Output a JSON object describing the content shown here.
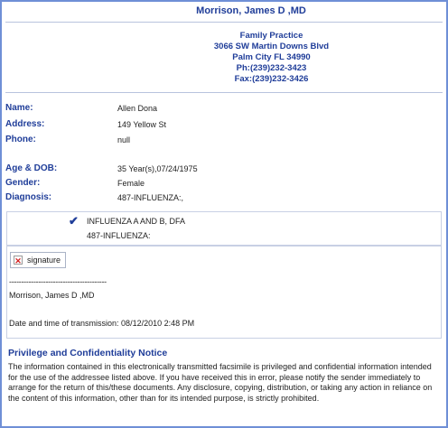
{
  "header": {
    "doctor": "Morrison, James D ,MD"
  },
  "practice": {
    "name": "Family Practice",
    "street": "3066 SW Martin Downs Blvd",
    "city": "Palm City FL 34990",
    "phone": "Ph:(239)232-3423",
    "fax": "Fax:(239)232-3426"
  },
  "patient": {
    "name_label": "Name:",
    "name_value": "Allen  Dona",
    "address_label": "Address:",
    "address_value": "149 Yellow St",
    "phone_label": "Phone:",
    "phone_value": "null",
    "age_label": "Age & DOB:",
    "age_value": "35 Year(s),07/24/1975",
    "gender_label": "Gender:",
    "gender_value": "Female",
    "diagnosis_label": "Diagnosis:",
    "diagnosis_value": "487-INFLUENZA:,"
  },
  "order": {
    "test": "INFLUENZA A AND B, DFA",
    "diagnosis": "487-INFLUENZA:"
  },
  "signature": {
    "image_label": "signature",
    "dashes": "----------------------------------------",
    "signer": "Morrison, James D ,MD",
    "transmission": "Date and time of transmission: 08/12/2010 2:48 PM"
  },
  "notice": {
    "title": "Privilege and Confidentiality Notice",
    "body": "The information contained in this electronically transmitted facsimile is privileged and confidential information intended for the use of the addressee listed above. If you have received this in error, please notify the sender immediately to arrange for the return of this/these documents. Any disclosure, copying, distribution, or taking any action in reliance on the content of this information, other than for its intended purpose, is strictly prohibited."
  },
  "colors": {
    "accent": "#1f3d99",
    "border": "#6f8fd6",
    "error_x": "#d21f1f"
  },
  "icons": {
    "check": "checkmark-icon",
    "broken_image": "broken-image-icon"
  }
}
